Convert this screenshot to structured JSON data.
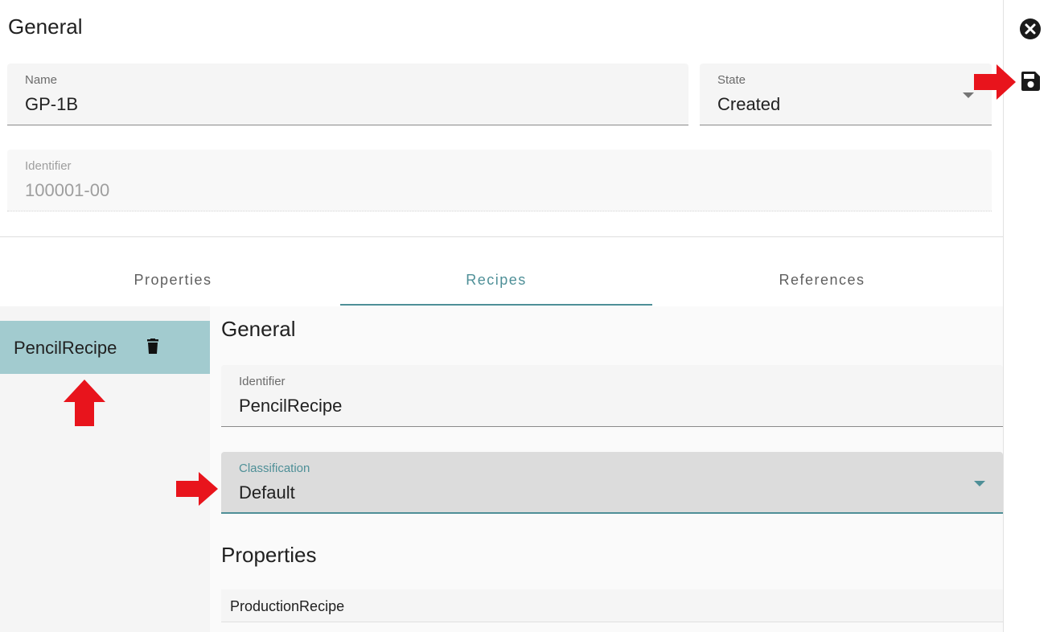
{
  "general": {
    "title": "General",
    "name": {
      "label": "Name",
      "value": "GP-1B"
    },
    "state": {
      "label": "State",
      "value": "Created"
    },
    "identifier": {
      "label": "Identifier",
      "value": "100001-00"
    }
  },
  "tabs": [
    {
      "label": "Properties",
      "active": false
    },
    {
      "label": "Recipes",
      "active": true
    },
    {
      "label": "References",
      "active": false
    }
  ],
  "recipes": {
    "list": [
      {
        "label": "PencilRecipe",
        "selected": true
      }
    ],
    "detail": {
      "general_title": "General",
      "identifier": {
        "label": "Identifier",
        "value": "PencilRecipe"
      },
      "classification": {
        "label": "Classification",
        "value": "Default"
      },
      "properties_title": "Properties",
      "properties_first_row": "ProductionRecipe"
    }
  },
  "toolbar": {
    "close_icon": "close-circle-icon",
    "save_icon": "save-icon"
  },
  "colors": {
    "accent": "#4e8f97",
    "selected_bg": "#a2cbcf",
    "annotation_arrow": "#e8141c"
  }
}
